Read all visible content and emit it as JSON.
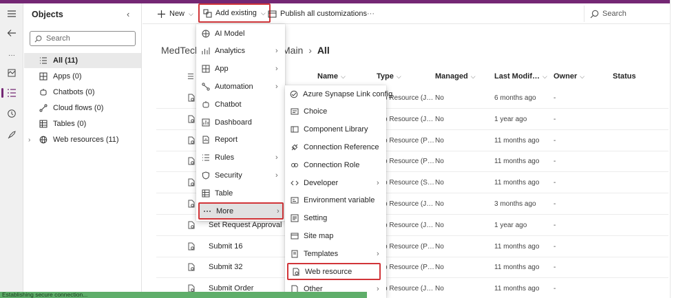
{
  "toolbar": {
    "new_label": "New",
    "add_existing_label": "Add existing",
    "publish_label": "Publish all customizations",
    "more_label": "···",
    "search_label": "Search"
  },
  "objects_panel": {
    "title": "Objects",
    "search_placeholder": "Search",
    "items": [
      {
        "label": "All  (11)"
      },
      {
        "label": "Apps  (0)"
      },
      {
        "label": "Chatbots  (0)"
      },
      {
        "label": "Cloud flows  (0)"
      },
      {
        "label": "Tables  (0)"
      },
      {
        "label": "Web resources  (11)"
      }
    ]
  },
  "breadcrumb": {
    "start": "MedTech",
    "end": "Main",
    "current": "All"
  },
  "table": {
    "headers": [
      "Name",
      "Type",
      "Managed",
      "Last Modif…",
      "Owner",
      "Status"
    ],
    "rows": [
      {
        "name": "",
        "type": "b Resource (J…",
        "managed": "No",
        "modified": "6 months ago",
        "owner": "-"
      },
      {
        "name": "",
        "type": "b Resource (J…",
        "managed": "No",
        "modified": "1 year ago",
        "owner": "-"
      },
      {
        "name": "",
        "type": "b Resource (P…",
        "managed": "No",
        "modified": "11 months ago",
        "owner": "-"
      },
      {
        "name": "",
        "type": "b Resource (P…",
        "managed": "No",
        "modified": "11 months ago",
        "owner": "-"
      },
      {
        "name": "",
        "type": "b Resource (S…",
        "managed": "No",
        "modified": "11 months ago",
        "owner": "-"
      },
      {
        "name": "",
        "type": "b Resource (J…",
        "managed": "No",
        "modified": "3 months ago",
        "owner": "-"
      },
      {
        "name": "Set Request Approval",
        "type": "b Resource (J…",
        "managed": "No",
        "modified": "1 year ago",
        "owner": "-"
      },
      {
        "name": "Submit 16",
        "type": "b Resource (P…",
        "managed": "No",
        "modified": "11 months ago",
        "owner": "-"
      },
      {
        "name": "Submit 32",
        "type": "b Resource (P…",
        "managed": "No",
        "modified": "11 months ago",
        "owner": "-"
      },
      {
        "name": "Submit Order",
        "type": "b Resource (J…",
        "managed": "No",
        "modified": "11 months ago",
        "owner": "-"
      }
    ]
  },
  "add_existing_menu": {
    "items": [
      {
        "label": "AI Model"
      },
      {
        "label": "Analytics"
      },
      {
        "label": "App"
      },
      {
        "label": "Automation"
      },
      {
        "label": "Chatbot"
      },
      {
        "label": "Dashboard"
      },
      {
        "label": "Report"
      },
      {
        "label": "Rules"
      },
      {
        "label": "Security"
      },
      {
        "label": "Table"
      },
      {
        "label": "More"
      }
    ]
  },
  "more_menu": {
    "items": [
      {
        "label": "Azure Synapse Link config"
      },
      {
        "label": "Choice"
      },
      {
        "label": "Component Library"
      },
      {
        "label": "Connection Reference"
      },
      {
        "label": "Connection Role"
      },
      {
        "label": "Developer"
      },
      {
        "label": "Environment variable"
      },
      {
        "label": "Setting"
      },
      {
        "label": "Site map"
      },
      {
        "label": "Templates"
      },
      {
        "label": "Web resource"
      },
      {
        "label": "Other"
      }
    ]
  },
  "status_bar": {
    "text": "Establishing secure connection..."
  },
  "colors": {
    "accent": "#742774",
    "highlight_border": "#d13438",
    "status_bar": "#5fae6a"
  }
}
